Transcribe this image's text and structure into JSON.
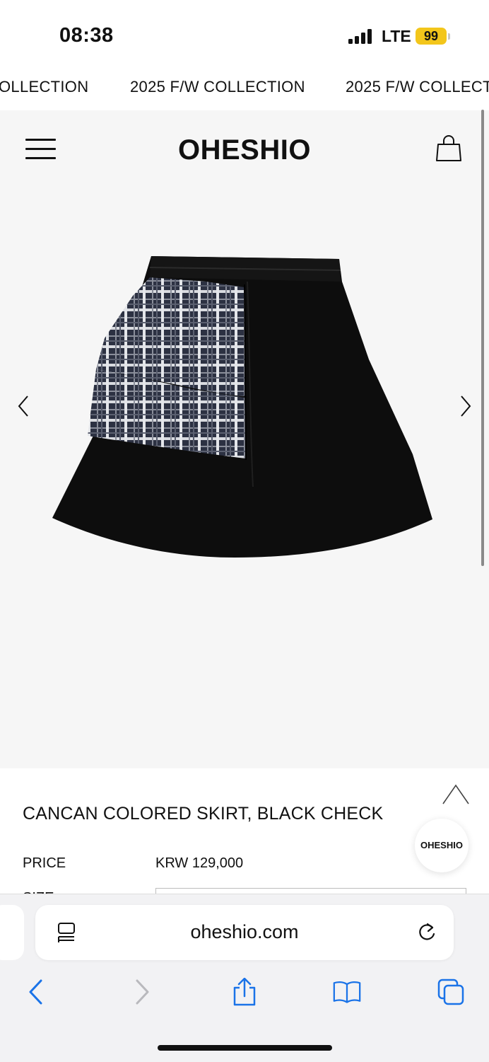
{
  "status_bar": {
    "time": "08:38",
    "network": "LTE",
    "battery": "99",
    "battery_color": "#f3c61b"
  },
  "marquee": {
    "items": [
      "OLLECTION",
      "2025 F/W COLLECTION",
      "2025 F/W COLLECT"
    ]
  },
  "header": {
    "logo": "OHESHIO",
    "menu_icon": "hamburger-menu-icon",
    "cart_icon": "shopping-bag-icon"
  },
  "gallery": {
    "prev_icon": "chevron-left-icon",
    "next_icon": "chevron-right-icon",
    "background": "#f6f6f6"
  },
  "product": {
    "title": "CANCAN COLORED SKIRT, BLACK CHECK",
    "price_label": "PRICE",
    "price_value": "KRW 129,000",
    "size_label": "SIZE"
  },
  "floating": {
    "top_icon": "chevron-up-icon",
    "brand_badge": "OHESHIO"
  },
  "browser": {
    "url": "oheshio.com",
    "reader_icon": "reader-mode-icon",
    "reload_icon": "reload-icon",
    "toolbar_icons": [
      "back-icon",
      "forward-icon",
      "share-icon",
      "bookmarks-icon",
      "tabs-icon"
    ],
    "accent": "#1a73e8"
  }
}
